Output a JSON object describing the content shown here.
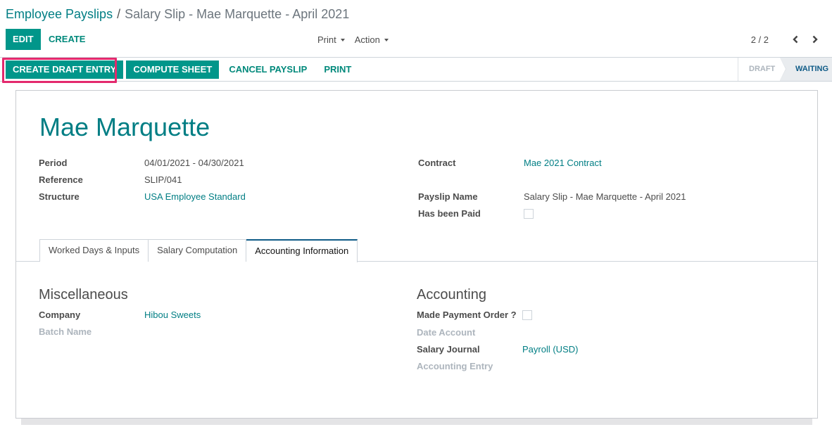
{
  "breadcrumb": {
    "parent": "Employee Payslips",
    "separator": "/",
    "current": "Salary Slip - Mae Marquette - April 2021"
  },
  "toolbar": {
    "edit_label": "EDIT",
    "create_label": "CREATE",
    "print_label": "Print",
    "action_label": "Action",
    "pager_value": "2 / 2",
    "prev_icon": "chevron-left-icon",
    "next_icon": "chevron-right-icon"
  },
  "statusbar": {
    "buttons": [
      {
        "label": "CREATE DRAFT ENTRY",
        "style": "primary",
        "highlighted": true
      },
      {
        "label": "COMPUTE SHEET",
        "style": "primary"
      },
      {
        "label": "CANCEL PAYSLIP",
        "style": "link"
      },
      {
        "label": "PRINT",
        "style": "link"
      }
    ],
    "stages": [
      {
        "label": "DRAFT",
        "active": false
      },
      {
        "label": "WAITING",
        "active": true
      }
    ],
    "highlight_color": "#e3296d"
  },
  "sheet": {
    "employee_name": "Mae Marquette",
    "left_fields": [
      {
        "label": "Period",
        "value": "04/01/2021 - 04/30/2021",
        "link": false
      },
      {
        "label": "Reference",
        "value": "SLIP/041",
        "link": false
      },
      {
        "label": "Structure",
        "value": "USA Employee Standard",
        "link": true
      }
    ],
    "right_fields": {
      "contract": {
        "label": "Contract",
        "value": "Mae 2021 Contract"
      },
      "payslip_name": {
        "label": "Payslip Name",
        "value": "Salary Slip - Mae Marquette - April 2021"
      },
      "has_been_paid": {
        "label": "Has been Paid",
        "checked": false
      }
    },
    "tabs": [
      {
        "label": "Worked Days & Inputs",
        "active": false
      },
      {
        "label": "Salary Computation",
        "active": false
      },
      {
        "label": "Accounting Information",
        "active": true
      }
    ],
    "miscellaneous": {
      "title": "Miscellaneous",
      "company_label": "Company",
      "company_value": "Hibou Sweets",
      "batch_label": "Batch Name"
    },
    "accounting": {
      "title": "Accounting",
      "payment_order_label": "Made Payment Order ?",
      "payment_order_checked": false,
      "date_account_label": "Date Account",
      "salary_journal_label": "Salary Journal",
      "salary_journal_value": "Payroll (USD)",
      "accounting_entry_label": "Accounting Entry"
    }
  },
  "colors": {
    "brand": "#017e84",
    "primary_button": "#01968a",
    "active_stage": "#0f5b87"
  }
}
